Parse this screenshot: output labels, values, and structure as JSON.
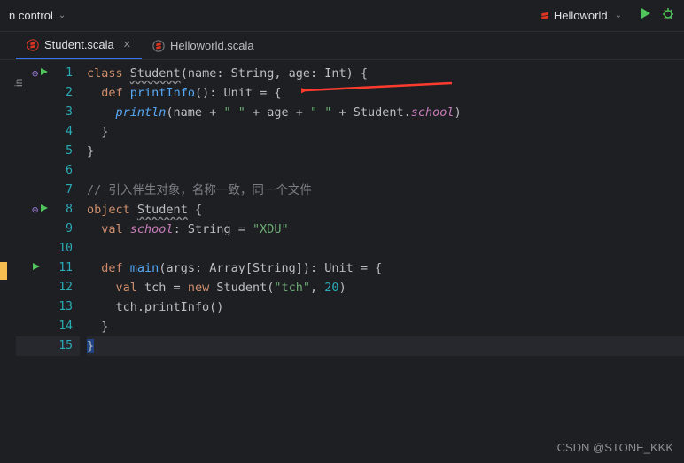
{
  "topbar": {
    "version_control": "n control",
    "run_config": "Helloworld"
  },
  "tabs": {
    "active": {
      "label": "Student.scala"
    },
    "other": {
      "label": "Helloworld.scala"
    }
  },
  "left_label": "in",
  "gutter": [
    "1",
    "2",
    "3",
    "4",
    "5",
    "6",
    "7",
    "8",
    "9",
    "10",
    "11",
    "12",
    "13",
    "14",
    "15"
  ],
  "code": {
    "l1": {
      "kw1": "class",
      "cls": "Student",
      "sig": "(name: String, age: Int) {"
    },
    "l2": {
      "kw1": "def",
      "fn": "printInfo",
      "sig": "(): Unit = {"
    },
    "l3": {
      "fn": "println",
      "p1": "(name + ",
      "s1": "\" \"",
      "p2": " + age + ",
      "s2": "\" \"",
      "p3": " + Student.",
      "field": "school",
      "p4": ")"
    },
    "l4": {
      "brace": "}"
    },
    "l5": {
      "brace": "}"
    },
    "l7": {
      "cmt": "// 引入伴生对象，名称一致，同一个文件"
    },
    "l8": {
      "kw1": "object",
      "cls": "Student",
      "brace": "{"
    },
    "l9": {
      "kw1": "val",
      "field": "school",
      "sig": ": String = ",
      "str": "\"XDU\""
    },
    "l11": {
      "kw1": "def",
      "fn": "main",
      "sig": "(args: Array[String]): Unit = {"
    },
    "l12": {
      "kw1": "val",
      "id": "tch = ",
      "kw2": "new",
      "cls": "Student(",
      "str": "\"tch\"",
      "comma": ", ",
      "num": "20",
      "close": ")"
    },
    "l13": {
      "txt": "tch.printInfo()"
    },
    "l14": {
      "brace": "}"
    },
    "l15": {
      "brace": "}"
    }
  },
  "watermark": "CSDN @STONE_KKK"
}
